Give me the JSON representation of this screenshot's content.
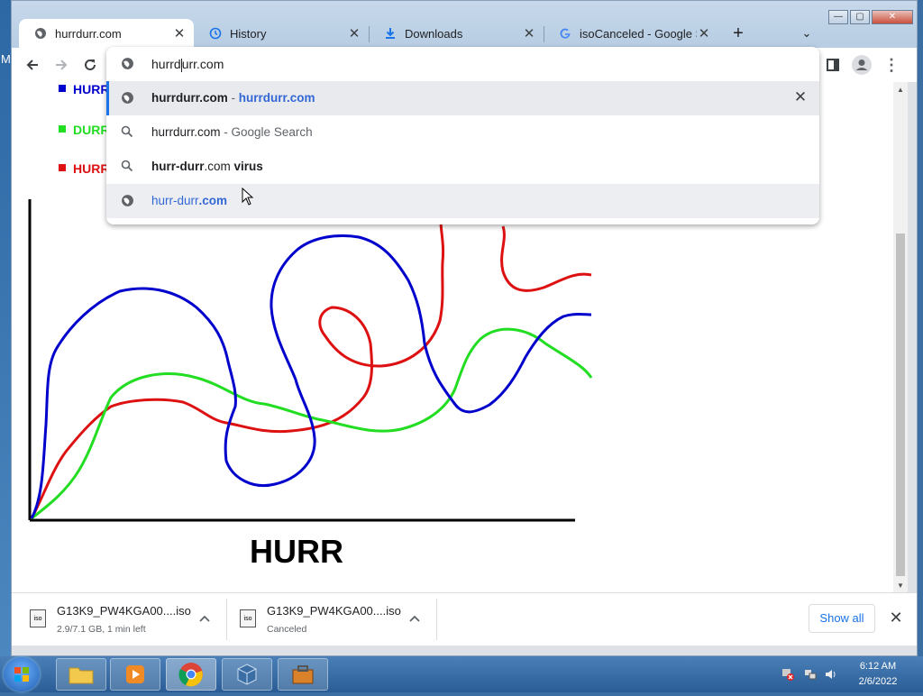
{
  "desktop": {
    "letter": "M"
  },
  "tabs": [
    {
      "title": "hurrdurr.com",
      "icon": "globe-icon",
      "close": "✕"
    },
    {
      "title": "History",
      "icon": "history-icon",
      "close": "✕"
    },
    {
      "title": "Downloads",
      "icon": "download-icon",
      "close": "✕"
    },
    {
      "title": "isoCanceled - Google Se",
      "icon": "google-icon",
      "close": "✕"
    }
  ],
  "tab_strip": {
    "new_tab": "+",
    "tab_search": "⌄"
  },
  "window_controls": {
    "minimize": "—",
    "maximize": "▢",
    "close": "✕"
  },
  "omnibox": {
    "text_before_caret": "hurrd",
    "text_after_caret": "urr.com"
  },
  "suggestions": [
    {
      "main": "hurrdurr.com",
      "sep": " - ",
      "detail": "hurrdurr.com",
      "icon": "globe-icon",
      "remove": "✕"
    },
    {
      "main": "hurrdurr.com",
      "sep": " - ",
      "detail": "Google Search",
      "icon": "search-icon"
    },
    {
      "bold": "hurr-durr",
      "plain": ".com ",
      "bold2": "virus",
      "icon": "search-icon"
    },
    {
      "plain": "hurr-durr",
      "bold": ".com",
      "icon": "globe-icon"
    }
  ],
  "page": {
    "legend": [
      {
        "label": "HURR",
        "color": "#0000cc"
      },
      {
        "label": "DURR",
        "color": "#22dd22"
      },
      {
        "label": "HURR",
        "color": "#dd1111"
      }
    ],
    "x_label": "HURR"
  },
  "downloads": [
    {
      "name": "G13K9_PW4KGA00....iso",
      "status": "2.9/7.1 GB, 1 min left",
      "icon_text": "iso"
    },
    {
      "name": "G13K9_PW4KGA00....iso",
      "status": "Canceled",
      "icon_text": "iso"
    }
  ],
  "shelf": {
    "show_all": "Show all",
    "close": "✕"
  },
  "taskbar": {
    "time": "6:12 AM",
    "date": "2/6/2022"
  },
  "colors": {
    "blue": "#0000cc",
    "green": "#22dd22",
    "red": "#dd1111",
    "accent": "#1a73e8"
  }
}
